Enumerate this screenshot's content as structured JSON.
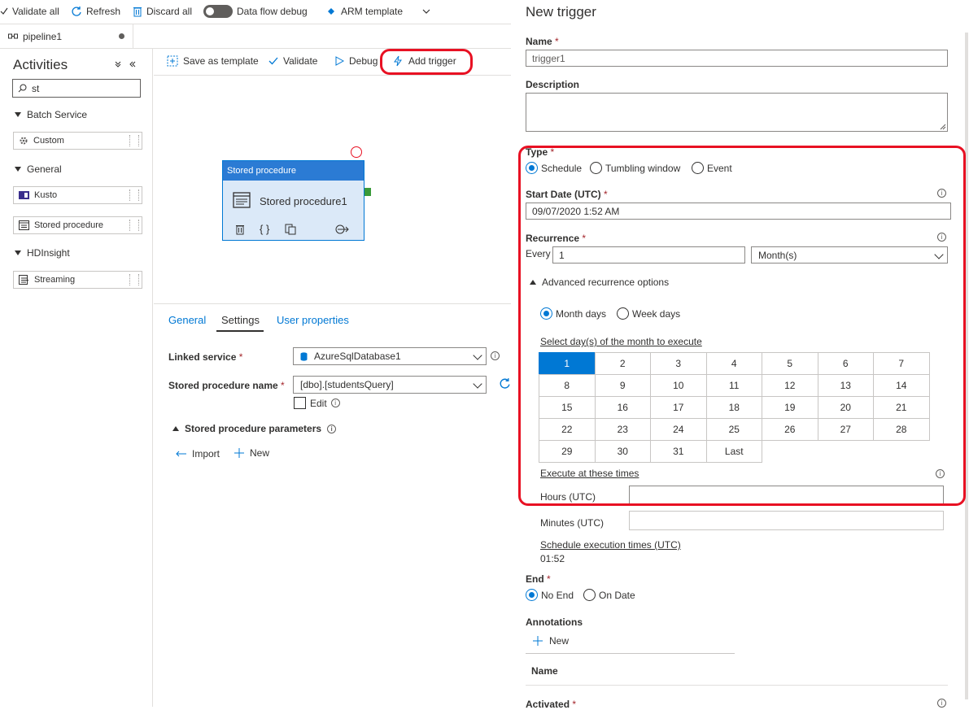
{
  "toolbar": {
    "validate_all": "Validate all",
    "refresh": "Refresh",
    "discard_all": "Discard all",
    "data_flow_debug": "Data flow debug",
    "arm_template": "ARM template"
  },
  "tab": {
    "name": "pipeline1"
  },
  "activities": {
    "title": "Activities",
    "search_value": "st",
    "sections": [
      {
        "label": "Batch Service",
        "items": [
          "Custom"
        ]
      },
      {
        "label": "General",
        "items": [
          "Kusto",
          "Stored procedure"
        ]
      },
      {
        "label": "HDInsight",
        "items": [
          "Streaming"
        ]
      }
    ]
  },
  "canvas_toolbar": {
    "save_as_template": "Save as template",
    "validate": "Validate",
    "debug": "Debug",
    "add_trigger": "Add trigger"
  },
  "node": {
    "type": "Stored procedure",
    "name": "Stored procedure1"
  },
  "bottom_tabs": [
    "General",
    "Settings",
    "User properties"
  ],
  "settings": {
    "linked_service_label": "Linked service",
    "linked_service_value": "AzureSqlDatabase1",
    "sp_name_label": "Stored procedure name",
    "sp_name_value": "[dbo].[studentsQuery]",
    "edit_label": "Edit",
    "params_label": "Stored procedure parameters",
    "import_label": "Import",
    "new_label": "New"
  },
  "trigger": {
    "title": "New trigger",
    "name_label": "Name",
    "name_value": "trigger1",
    "description_label": "Description",
    "type_label": "Type",
    "type_options": [
      "Schedule",
      "Tumbling window",
      "Event"
    ],
    "start_date_label": "Start Date (UTC)",
    "start_date_value": "09/07/2020 1:52 AM",
    "recurrence_label": "Recurrence",
    "every_label": "Every",
    "every_value": "1",
    "unit_value": "Month(s)",
    "advanced_label": "Advanced recurrence options",
    "day_mode_options": [
      "Month days",
      "Week days"
    ],
    "select_days_label": "Select day(s) of the month to execute",
    "days": [
      "1",
      "2",
      "3",
      "4",
      "5",
      "6",
      "7",
      "8",
      "9",
      "10",
      "11",
      "12",
      "13",
      "14",
      "15",
      "16",
      "17",
      "18",
      "19",
      "20",
      "21",
      "22",
      "23",
      "24",
      "25",
      "26",
      "27",
      "28",
      "29",
      "30",
      "31",
      "Last"
    ],
    "execute_times_label": "Execute at these times",
    "hours_label": "Hours (UTC)",
    "minutes_label": "Minutes (UTC)",
    "schedule_times_label": "Schedule execution times (UTC)",
    "schedule_times_value": "01:52",
    "end_label": "End",
    "end_options": [
      "No End",
      "On Date"
    ],
    "annotations_label": "Annotations",
    "annotations_new": "New",
    "annotation_col_name": "Name",
    "activated_label": "Activated",
    "required_mark": "*"
  },
  "colors": {
    "accent": "#0078d4",
    "highlight": "#e81123"
  }
}
